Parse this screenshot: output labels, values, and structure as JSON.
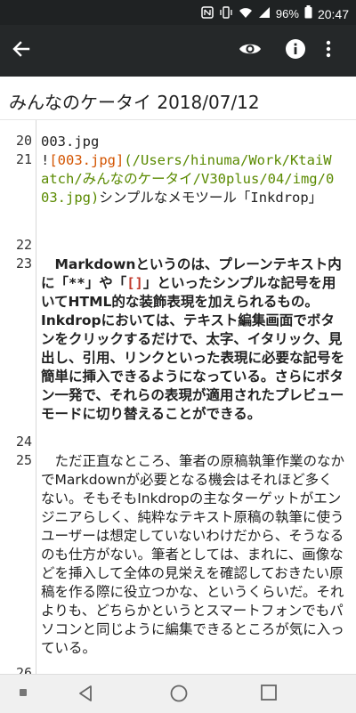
{
  "status_bar": {
    "battery_percent": "96%",
    "time": "20:47",
    "icons": [
      "nfc-icon",
      "vibrate-icon",
      "wifi-icon",
      "signal-icon",
      "battery-icon"
    ]
  },
  "app_bar": {
    "icons": [
      "back-arrow-icon",
      "eye-icon",
      "info-icon",
      "more-vert-icon"
    ]
  },
  "title": "みんなのケータイ 2018/07/12",
  "editor": {
    "line20": {
      "num": "20",
      "text": "003.jpg"
    },
    "line21": {
      "num": "21",
      "bang": "!",
      "alt": "[003.jpg]",
      "url": "(/Users/hinuma/Work/KtaiWatch/みんなのケータイ/V30plus/04/img/003.jpg)",
      "tail": "シンプルなメモツール「Inkdrop」"
    },
    "line22": {
      "num": "22"
    },
    "line23": {
      "num": "23",
      "intro": "　Markdownというのは、プレーンテキスト内に「",
      "mark1": "**",
      "mid1": "」や「",
      "mark2": "[]",
      "rest": "」といったシンプルな記号を用いてHTML的な装飾表現を加えられるもの。Inkdropにおいては、テキスト編集画面でボタンをクリックするだけで、太字、イタリック、見出し、引用、リンクといった表現に必要な記号を簡単に挿入できるようになっている。さらにボタン一発で、それらの表現が適用されたプレビューモードに切り替えることができる。"
    },
    "line24": {
      "num": "24"
    },
    "line25": {
      "num": "25",
      "text": "　ただ正直なところ、筆者の原稿執筆作業のなかでMarkdownが必要となる機会はそれほど多くない。そもそもInkdropの主なターゲットがエンジニアらしく、純粋なテキスト原稿の執筆に使うユーザーは想定していないわけだから、そうなるのも仕方がない。筆者としては、まれに、画像などを挿入して全体の見栄えを確認しておきたい原稿を作る際に役立つかな、というくらいだ。それよりも、どちらかというとスマートフォンでもパソコンと同じように編集できるところが気に入っている。"
    },
    "line26": {
      "num": "26"
    }
  },
  "nav_bar": {
    "icons": [
      "square-dot-icon",
      "nav-back-icon",
      "nav-home-icon",
      "nav-recents-icon"
    ]
  }
}
